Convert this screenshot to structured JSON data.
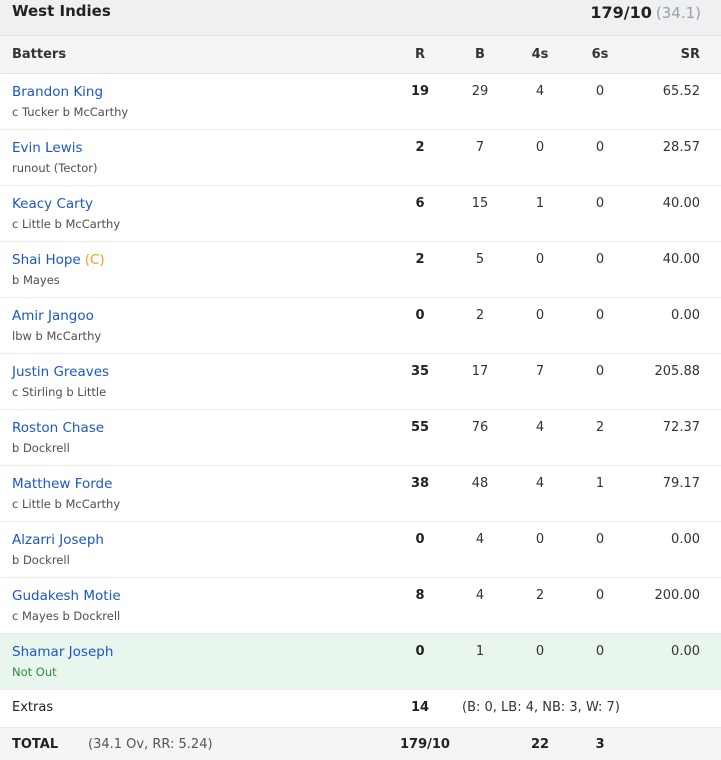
{
  "team": {
    "name": "West Indies",
    "score": "179/10",
    "overs": "(34.1)"
  },
  "columns": {
    "batters": "Batters",
    "r": "R",
    "b": "B",
    "fours": "4s",
    "sixes": "6s",
    "sr": "SR"
  },
  "batters": [
    {
      "name": "Brandon King",
      "captain": "",
      "dismissal": "c Tucker b McCarthy",
      "r": "19",
      "b": "29",
      "fours": "4",
      "sixes": "0",
      "sr": "65.52"
    },
    {
      "name": "Evin Lewis",
      "captain": "",
      "dismissal": "runout (Tector)",
      "r": "2",
      "b": "7",
      "fours": "0",
      "sixes": "0",
      "sr": "28.57"
    },
    {
      "name": "Keacy Carty",
      "captain": "",
      "dismissal": "c Little b McCarthy",
      "r": "6",
      "b": "15",
      "fours": "1",
      "sixes": "0",
      "sr": "40.00"
    },
    {
      "name": "Shai Hope",
      "captain": "(C)",
      "dismissal": "b Mayes",
      "r": "2",
      "b": "5",
      "fours": "0",
      "sixes": "0",
      "sr": "40.00"
    },
    {
      "name": "Amir Jangoo",
      "captain": "",
      "dismissal": "lbw b McCarthy",
      "r": "0",
      "b": "2",
      "fours": "0",
      "sixes": "0",
      "sr": "0.00"
    },
    {
      "name": "Justin Greaves",
      "captain": "",
      "dismissal": "c Stirling b Little",
      "r": "35",
      "b": "17",
      "fours": "7",
      "sixes": "0",
      "sr": "205.88"
    },
    {
      "name": "Roston Chase",
      "captain": "",
      "dismissal": "b Dockrell",
      "r": "55",
      "b": "76",
      "fours": "4",
      "sixes": "2",
      "sr": "72.37"
    },
    {
      "name": "Matthew Forde",
      "captain": "",
      "dismissal": "c Little b McCarthy",
      "r": "38",
      "b": "48",
      "fours": "4",
      "sixes": "1",
      "sr": "79.17"
    },
    {
      "name": "Alzarri Joseph",
      "captain": "",
      "dismissal": "b Dockrell",
      "r": "0",
      "b": "4",
      "fours": "0",
      "sixes": "0",
      "sr": "0.00"
    },
    {
      "name": "Gudakesh Motie",
      "captain": "",
      "dismissal": "c Mayes b Dockrell",
      "r": "8",
      "b": "4",
      "fours": "2",
      "sixes": "0",
      "sr": "200.00"
    },
    {
      "name": "Shamar Joseph",
      "captain": "",
      "dismissal": "Not Out",
      "r": "0",
      "b": "1",
      "fours": "0",
      "sixes": "0",
      "sr": "0.00"
    }
  ],
  "extras": {
    "label": "Extras",
    "value": "14",
    "detail": "(B: 0, LB: 4, NB: 3, W: 7)"
  },
  "total": {
    "label": "TOTAL",
    "info": "(34.1 Ov, RR: 5.24)",
    "score": "179/10",
    "fours": "22",
    "sixes": "3"
  },
  "colors": {
    "link": "#1a57c9",
    "captain": "#f0a020",
    "not_out_bg": "#e8f6ee",
    "not_out_text": "#2e8b3a",
    "header_bg": "#eef0f2"
  }
}
